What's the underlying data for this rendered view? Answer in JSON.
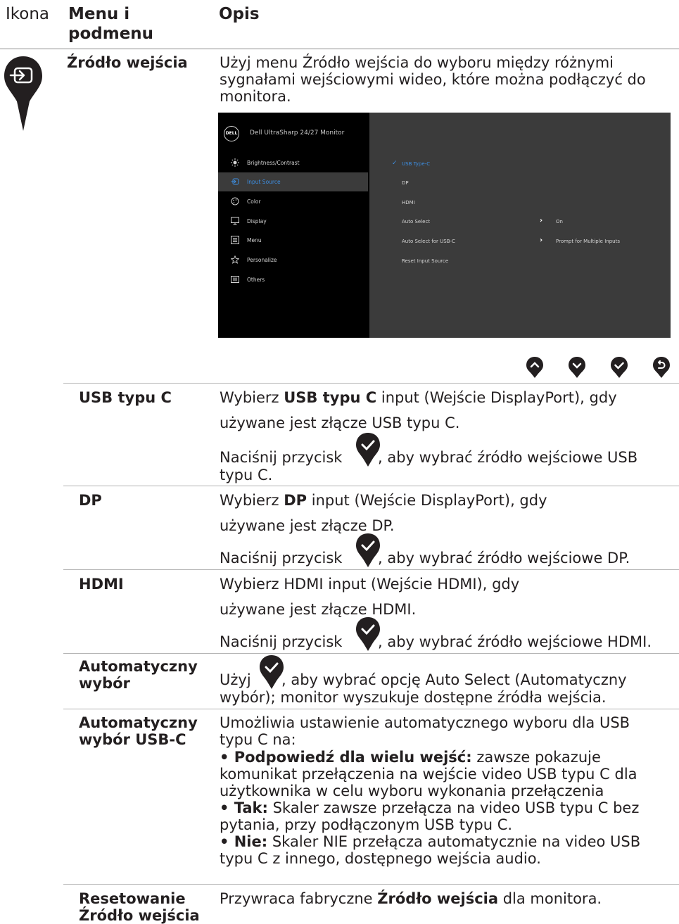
{
  "header": {
    "col_icon": "Ikona",
    "col_menu": "Menu i podmenu",
    "col_desc": "Opis"
  },
  "section": {
    "name": "Źródło wejścia",
    "desc": "Użyj menu Źródło wejścia do wyboru między różnymi sygnałami wejściowymi wideo, które można podłączyć do monitora."
  },
  "osd": {
    "title": "Dell UltraSharp 24/27 Monitor",
    "logo": "DELL",
    "menu": [
      {
        "label": "Brightness/Contrast",
        "icon": "sun-icon"
      },
      {
        "label": "Input Source",
        "icon": "input-source-icon",
        "selected": true
      },
      {
        "label": "Color",
        "icon": "palette-icon"
      },
      {
        "label": "Display",
        "icon": "monitor-icon"
      },
      {
        "label": "Menu",
        "icon": "menu-list-icon"
      },
      {
        "label": "Personalize",
        "icon": "star-icon"
      },
      {
        "label": "Others",
        "icon": "others-icon"
      }
    ],
    "submenu": [
      {
        "label": "USB Type-C",
        "selected": true
      },
      {
        "label": "DP"
      },
      {
        "label": "HDMI"
      },
      {
        "label": "Auto Select",
        "value": "On"
      },
      {
        "label": "Auto Select for USB-C",
        "value": "Prompt for Multiple Inputs"
      },
      {
        "label": "Reset Input Source"
      }
    ],
    "colors": {
      "accent": "#3d8fe3",
      "panel": "#000000",
      "subpanel": "#3b3b3b"
    }
  },
  "buttons": [
    "up-pin-icon",
    "down-pin-icon",
    "check-pin-icon",
    "back-pin-icon"
  ],
  "rows": {
    "usbc": {
      "name": "USB typu C",
      "p1_pre": "Wybierz ",
      "p1_bold": "USB typu C",
      "p1_post": " input (Wejście DisplayPort), gdy",
      "p1_line2": "używane jest złącze USB typu C.",
      "p2_pre": "Naciśnij przycisk ",
      "p2_post": ", aby wybrać źródło wejściowe USB",
      "p2_line2": "typu C."
    },
    "dp": {
      "name": "DP",
      "p1_pre": "Wybierz ",
      "p1_bold": "DP",
      "p1_post": " input (Wejście DisplayPort), gdy",
      "p1_line2": "używane jest złącze DP.",
      "p2_pre": "Naciśnij przycisk ",
      "p2_post": ", aby wybrać źródło wejściowe DP."
    },
    "hdmi": {
      "name": "HDMI",
      "p1": "Wybierz HDMI input (Wejście HDMI), gdy",
      "p1_line2": "używane jest złącze HDMI.",
      "p2_pre": "Naciśnij przycisk ",
      "p2_post": ", aby wybrać źródło wejściowe HDMI."
    },
    "auto": {
      "name_1": "Automatyczny",
      "name_2": "wybór",
      "p_pre": "Użyj ",
      "p_post": ", aby wybrać opcję Auto Select (Automatyczny",
      "p_line2": "wybór); monitor wyszukuje dostępne źródła wejścia."
    },
    "autousbc": {
      "name_1": "Automatyczny",
      "name_2": "wybór USB-C",
      "l1": "Umożliwia ustawienie automatycznego wyboru dla USB",
      "l2": "typu C na:",
      "b1_bold": "• Podpowiedź dla wielu wejść:",
      "b1_rest": " zawsze pokazuje",
      "l4": "komunikat przełączenia na wejście video USB typu C dla",
      "l5": "użytkownika w celu wyboru wykonania przełączenia",
      "b2_bold": "• Tak:",
      "b2_rest": " Skaler zawsze przełącza na video USB typu C bez",
      "l7": "pytania, przy podłączonym USB typu C.",
      "b3_bold": "• Nie:",
      "b3_rest": " Skaler NIE przełącza automatycznie na video USB",
      "l9": "typu C z innego, dostępnego wejścia audio."
    },
    "reset": {
      "name_1": "Resetowanie",
      "name_2": "Źródło wejścia",
      "p_pre": "Przywraca fabryczne ",
      "p_bold": "Źródło wejścia",
      "p_post": " dla monitora."
    }
  }
}
